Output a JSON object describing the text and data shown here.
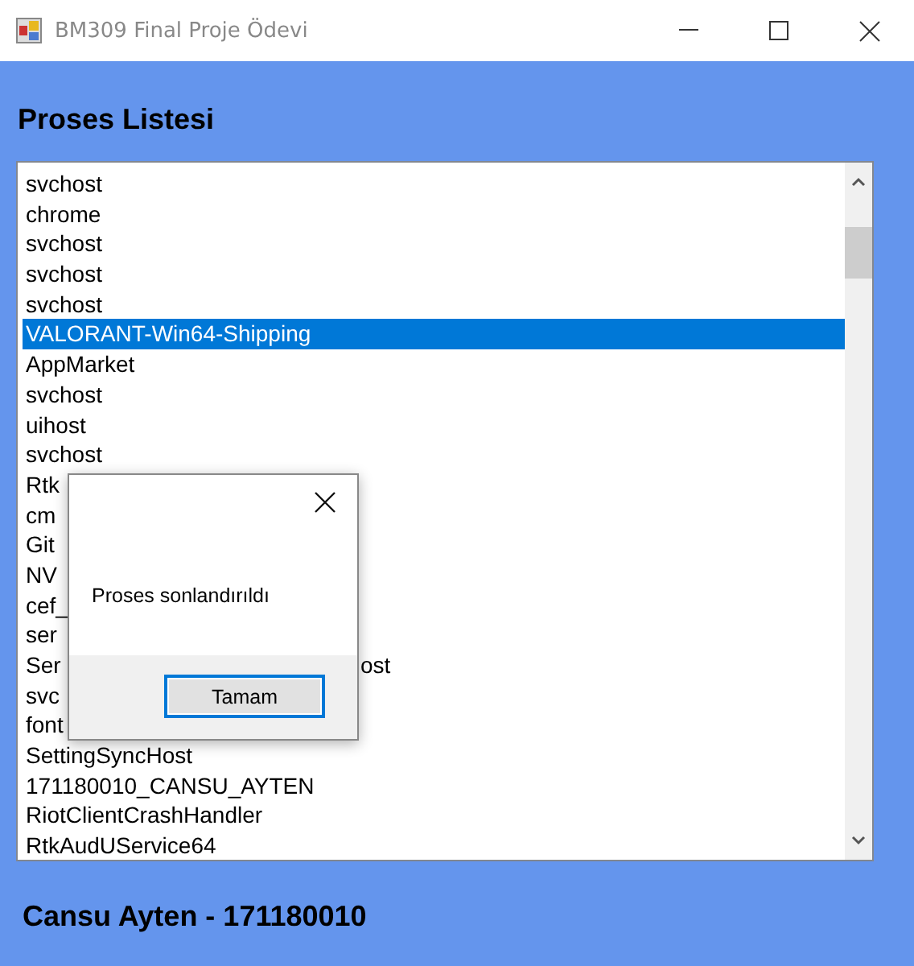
{
  "window": {
    "title": "BM309 Final Proje Ödevi"
  },
  "heading": "Proses Listesi",
  "process_list": [
    {
      "text": "svchost",
      "selected": false
    },
    {
      "text": "chrome",
      "selected": false
    },
    {
      "text": "svchost",
      "selected": false
    },
    {
      "text": "svchost",
      "selected": false
    },
    {
      "text": "svchost",
      "selected": false
    },
    {
      "text": "VALORANT-Win64-Shipping",
      "selected": true
    },
    {
      "text": "AppMarket",
      "selected": false
    },
    {
      "text": "svchost",
      "selected": false
    },
    {
      "text": "uihost",
      "selected": false
    },
    {
      "text": "svchost",
      "selected": false
    },
    {
      "text": "Rtk",
      "selected": false
    },
    {
      "text": "cm",
      "selected": false
    },
    {
      "text": "Git",
      "selected": false
    },
    {
      "text": "NV",
      "selected": false
    },
    {
      "text": "cef_",
      "selected": false
    },
    {
      "text": "ser",
      "selected": false
    },
    {
      "text": "Ser",
      "tail": "ost",
      "selected": false
    },
    {
      "text": "svc",
      "selected": false
    },
    {
      "text": "font",
      "selected": false
    },
    {
      "text": "SettingSyncHost",
      "selected": false
    },
    {
      "text": "171180010_CANSU_AYTEN",
      "selected": false
    },
    {
      "text": "RiotClientCrashHandler",
      "selected": false
    },
    {
      "text": "RtkAudUService64",
      "selected": false
    }
  ],
  "footer": "Cansu Ayten - 171180010",
  "dialog": {
    "message": "Proses sonlandırıldı",
    "button": "Tamam"
  }
}
